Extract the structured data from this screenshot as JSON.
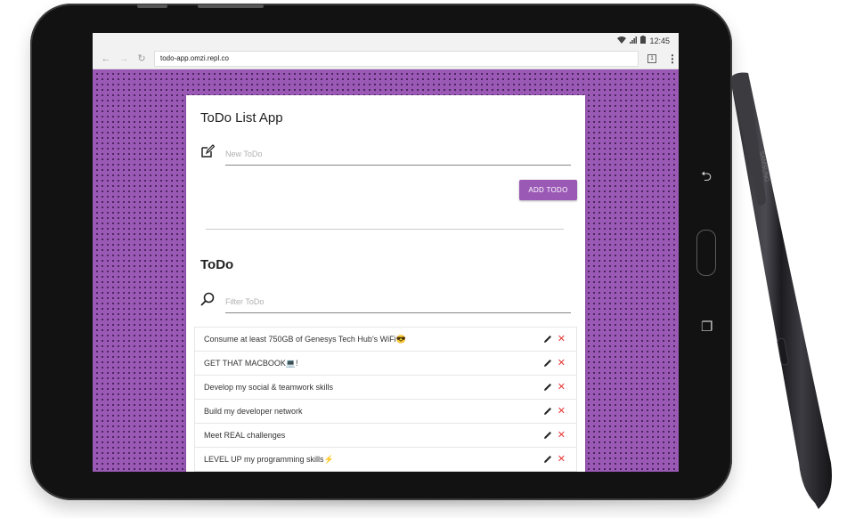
{
  "device": {
    "nav_back_icon": "back-arrow-icon",
    "nav_home_icon": "home-button",
    "nav_recents_icon": "recent-apps-icon",
    "stylus_brand": "SAMSUNG"
  },
  "status_bar": {
    "icons": [
      "wifi-icon",
      "signal-icon",
      "battery-icon"
    ],
    "time": "12:45"
  },
  "browser": {
    "back_glyph": "←",
    "forward_glyph": "→",
    "reload_glyph": "↻",
    "url": "todo-app.omzi.repl.co",
    "tab_count": "1",
    "menu_glyph": "⋮"
  },
  "app": {
    "title": "ToDo List App",
    "new_todo": {
      "value": "",
      "placeholder": "New ToDo"
    },
    "add_button_label": "ADD TODO",
    "list_title": "ToDo",
    "filter": {
      "value": "",
      "placeholder": "Filter ToDo"
    },
    "delete_glyph": "✕",
    "accent_color": "#9b59b6",
    "delete_color": "#e53935",
    "todos": [
      {
        "text": "Consume at least 750GB of Genesys Tech Hub's WiFi😎"
      },
      {
        "text": "GET THAT MACBOOK💻!"
      },
      {
        "text": "Develop my social & teamwork skills"
      },
      {
        "text": "Build my developer network"
      },
      {
        "text": "Meet REAL challenges"
      },
      {
        "text": "LEVEL UP my programming skills⚡"
      }
    ]
  }
}
